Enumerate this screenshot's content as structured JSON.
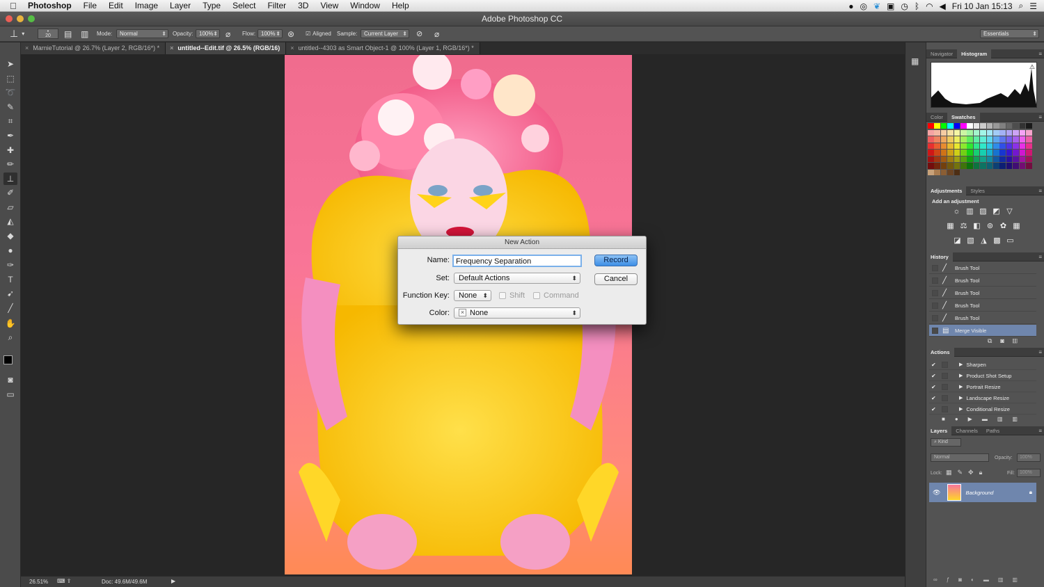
{
  "menubar": {
    "app": "Photoshop",
    "items": [
      "File",
      "Edit",
      "Image",
      "Layer",
      "Type",
      "Select",
      "Filter",
      "3D",
      "View",
      "Window",
      "Help"
    ],
    "clock": "Fri 10 Jan  15:13"
  },
  "window_title": "Adobe Photoshop CC",
  "options_bar": {
    "brush_size": "20",
    "mode_label": "Mode:",
    "mode_value": "Normal",
    "opacity_label": "Opacity:",
    "opacity_value": "100%",
    "flow_label": "Flow:",
    "flow_value": "100%",
    "aligned_label": "Aligned",
    "sample_label": "Sample:",
    "sample_value": "Current Layer",
    "workspace": "Essentials"
  },
  "tabs": [
    {
      "label": "MarnieTutorial @ 26.7% (Layer 2, RGB/16*) *"
    },
    {
      "label": "untitled--Edit.tif @ 26.5% (RGB/16)"
    },
    {
      "label": "untitled--4303 as Smart Object-1 @ 100% (Layer 1, RGB/16*) *"
    }
  ],
  "status": {
    "zoom": "26.51%",
    "doc": "Doc: 49.6M/49.6M"
  },
  "panels": {
    "nav_tabs": [
      "Navigator",
      "Histogram"
    ],
    "color_tabs": [
      "Color",
      "Swatches"
    ],
    "adj_tabs": [
      "Adjustments",
      "Styles"
    ],
    "adj_subtitle": "Add an adjustment",
    "history_title": "History",
    "history_items": [
      "Brush Tool",
      "Brush Tool",
      "Brush Tool",
      "Brush Tool",
      "Brush Tool",
      "Merge Visible"
    ],
    "actions_title": "Actions",
    "action_items": [
      "Sharpen",
      "Product Shot Setup",
      "Portrait Resize",
      "Landscape Resize",
      "Conditional Resize"
    ],
    "layer_tabs": [
      "Layers",
      "Channels",
      "Paths"
    ],
    "layer_kind": "Kind",
    "layer_blend": "Normal",
    "layer_opacity_label": "Opacity:",
    "layer_opacity_value": "100%",
    "lock_label": "Lock:",
    "fill_label": "Fill:",
    "fill_value": "100%",
    "layer_name": "Background"
  },
  "dialog": {
    "title": "New Action",
    "name_label": "Name:",
    "name_value": "Frequency Separation",
    "set_label": "Set:",
    "set_value": "Default Actions",
    "fkey_label": "Function Key:",
    "fkey_value": "None",
    "shift_label": "Shift",
    "command_label": "Command",
    "color_label": "Color:",
    "color_value": "None",
    "record_label": "Record",
    "cancel_label": "Cancel"
  },
  "colors": {
    "selection": "#6f86ad",
    "record_button": "#3d8ee6"
  }
}
